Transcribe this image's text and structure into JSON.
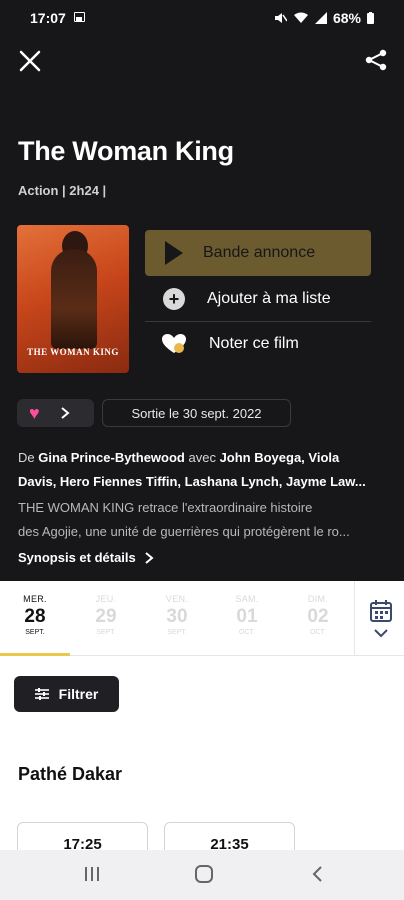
{
  "status_bar": {
    "time": "17:07",
    "battery": "68%"
  },
  "movie": {
    "title": "The Woman King",
    "meta": "Action | 2h24 |",
    "poster_title": "THE WOMAN KING",
    "release": "Sortie le 30 sept. 2022"
  },
  "actions": {
    "trailer": "Bande annonce",
    "add_list": "Ajouter à ma liste",
    "rate": "Noter ce film"
  },
  "credits": {
    "prefix": "De ",
    "director": "Gina Prince-Bythewood",
    "with": " avec ",
    "cast_line1": "John Boyega, Viola",
    "cast_line2": "Davis, Hero Fiennes Tiffin, Lashana Lynch, Jayme Law..."
  },
  "synopsis": {
    "line1": "THE WOMAN KING retrace l'extraordinaire histoire",
    "line2": "des Agojie, une unité de guerrières qui protégèrent le ro...",
    "link": "Synopsis et détails"
  },
  "dates": [
    {
      "name": "MER.",
      "day": "28",
      "month": "SEPT.",
      "active": true
    },
    {
      "name": "JEU.",
      "day": "29",
      "month": "SEPT.",
      "active": false
    },
    {
      "name": "VEN.",
      "day": "30",
      "month": "SEPT.",
      "active": false
    },
    {
      "name": "SAM.",
      "day": "01",
      "month": "OCT.",
      "active": false
    },
    {
      "name": "DIM.",
      "day": "02",
      "month": "OCT.",
      "active": false
    }
  ],
  "filter_label": "Filtrer",
  "cinema": {
    "name": "Pathé Dakar",
    "showtimes": [
      "17:25",
      "21:35"
    ]
  },
  "colors": {
    "background_dark": "#17171a",
    "trailer_button": "#6b5b2f",
    "favorite_heart": "#ff4fa0",
    "active_date_underline": "#e9c84d"
  },
  "icons": {
    "close": "close-icon",
    "share": "share-icon",
    "play": "play-icon",
    "add": "plus-circle-icon",
    "rate": "heart-rate-icon",
    "favorite": "heart-icon",
    "calendar": "calendar-icon",
    "filter": "sliders-icon"
  }
}
